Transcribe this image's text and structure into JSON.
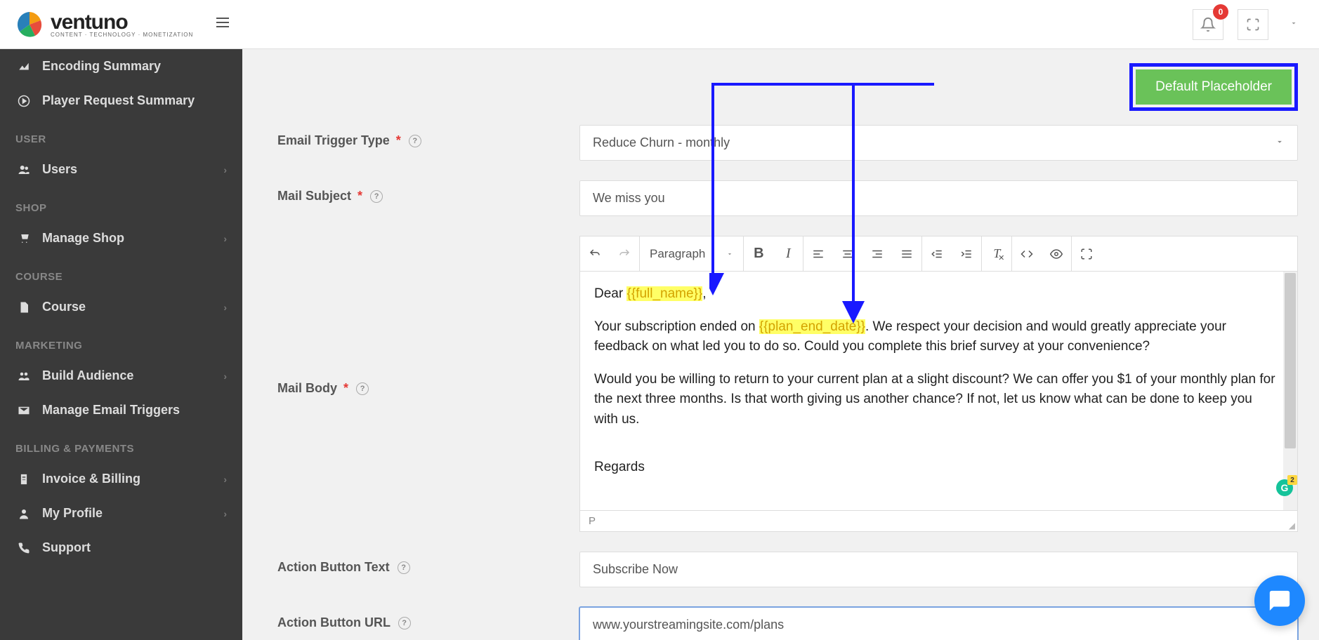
{
  "header": {
    "brand": "ventuno",
    "tagline": "CONTENT · TECHNOLOGY · MONETIZATION",
    "notif_count": "0"
  },
  "sidebar": {
    "items": [
      {
        "label": "Encoding Summary",
        "icon": "chart"
      },
      {
        "label": "Player Request Summary",
        "icon": "play"
      }
    ],
    "sections": [
      {
        "title": "USER",
        "items": [
          {
            "label": "Users",
            "icon": "users",
            "chev": true
          }
        ]
      },
      {
        "title": "SHOP",
        "items": [
          {
            "label": "Manage Shop",
            "icon": "cart",
            "chev": true
          }
        ]
      },
      {
        "title": "COURSE",
        "items": [
          {
            "label": "Course",
            "icon": "file",
            "chev": true
          }
        ]
      },
      {
        "title": "MARKETING",
        "items": [
          {
            "label": "Build Audience",
            "icon": "aud",
            "chev": true
          },
          {
            "label": "Manage Email Triggers",
            "icon": "mail",
            "chev": false
          }
        ]
      },
      {
        "title": "BILLING & PAYMENTS",
        "items": [
          {
            "label": "Invoice & Billing",
            "icon": "doc",
            "chev": true
          },
          {
            "label": "My Profile",
            "icon": "user",
            "chev": true
          },
          {
            "label": "Support",
            "icon": "phone",
            "chev": false
          }
        ]
      }
    ]
  },
  "form": {
    "default_placeholder_btn": "Default Placeholder",
    "trigger_label": "Email Trigger Type",
    "trigger_value": "Reduce Churn - monthly",
    "subject_label": "Mail Subject",
    "subject_value": "We miss you",
    "body_label": "Mail Body",
    "action_text_label": "Action Button Text",
    "action_text_value": "Subscribe Now",
    "action_url_label": "Action Button URL",
    "action_url_value": "www.yourstreamingsite.com/plans"
  },
  "editor": {
    "format": "Paragraph",
    "status": "P",
    "body_parts": {
      "p1_a": "Dear ",
      "p1_hl": "{{full_name}}",
      "p1_b": ",",
      "p2_a": "Your subscription ended on ",
      "p2_hl": "{{plan_end_date}}",
      "p2_b": ". We respect your decision and would greatly appreciate your feedback on what led you to do so. Could you complete this brief survey at your convenience?",
      "p3": "Would you be willing to return to your current plan at a slight discount? We can offer you $1 of your monthly plan for the next three months. Is that worth giving us another chance? If not, let us know what can be done to keep you with us.",
      "p4": "Regards"
    },
    "grammarly_count": "2"
  }
}
